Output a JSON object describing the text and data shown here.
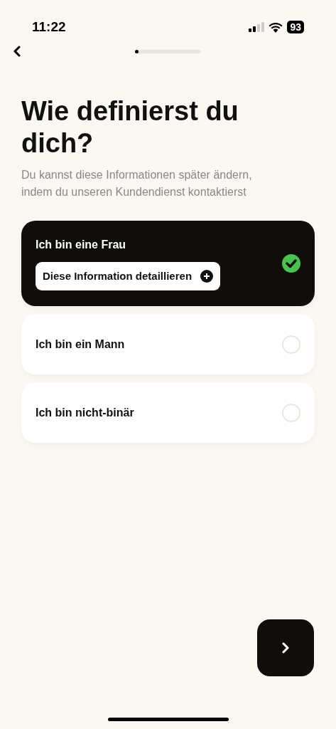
{
  "status_bar": {
    "time": "11:22",
    "battery": "93"
  },
  "progress": {
    "level": 0.05
  },
  "title": "Wie definierst du dich?",
  "subtitle": "Du kannst diese Informationen später ändern, indem du unseren Kundendienst kontaktierst",
  "options": [
    {
      "label": "Ich bin eine Frau",
      "selected": true,
      "detail_button": "Diese Information detaillieren"
    },
    {
      "label": "Ich bin ein Mann",
      "selected": false
    },
    {
      "label": "Ich bin nicht-binär",
      "selected": false
    }
  ]
}
